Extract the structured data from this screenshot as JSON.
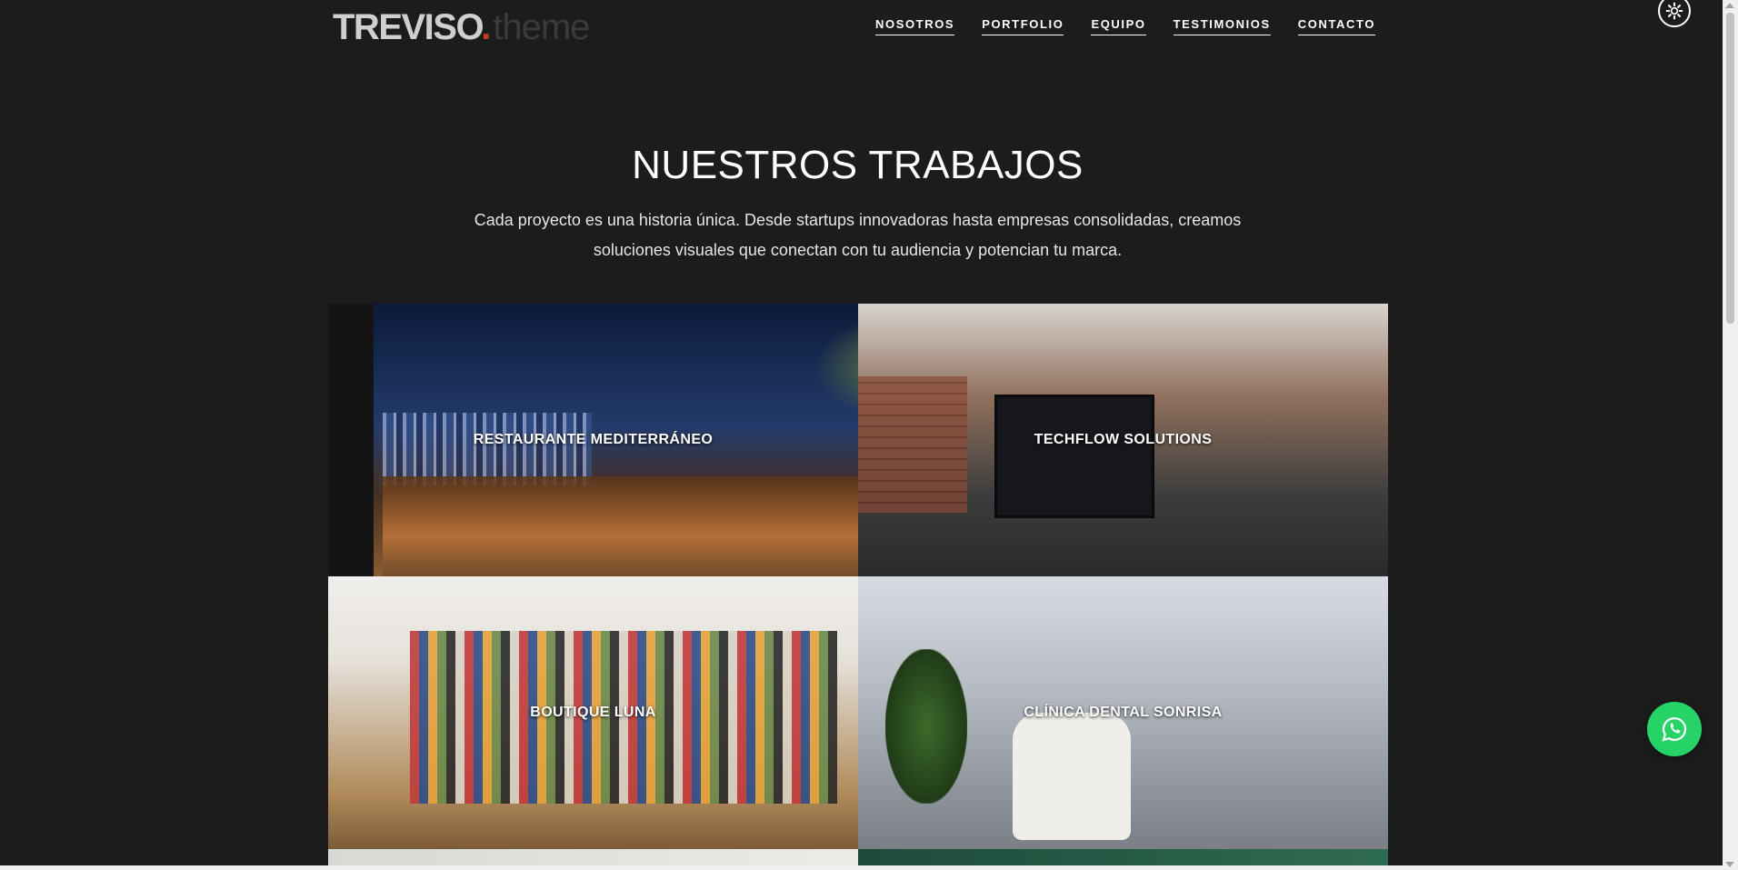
{
  "header": {
    "logo_main": "TREVISO",
    "logo_dot": ".",
    "logo_sub": "theme",
    "nav": [
      "NOSOTROS",
      "PORTFOLIO",
      "EQUIPO",
      "TESTIMONIOS",
      "CONTACTO"
    ]
  },
  "section": {
    "title": "NUESTROS TRABAJOS",
    "intro": "Cada proyecto es una historia única. Desde startups innovadoras hasta empresas consolidadas, creamos soluciones visuales que conectan con tu audiencia y potencian tu marca."
  },
  "portfolio": [
    {
      "label": "RESTAURANTE MEDITERRÁNEO"
    },
    {
      "label": "TECHFLOW SOLUTIONS"
    },
    {
      "label": "BOUTIQUE LUNA"
    },
    {
      "label": "CLÍNICA DENTAL SONRISA"
    }
  ],
  "icons": {
    "settings": "gear-icon",
    "whatsapp": "whatsapp-icon"
  },
  "colors": {
    "background": "#1c1c1c",
    "whatsapp": "#25d366",
    "logo_accent": "#c0392b"
  }
}
